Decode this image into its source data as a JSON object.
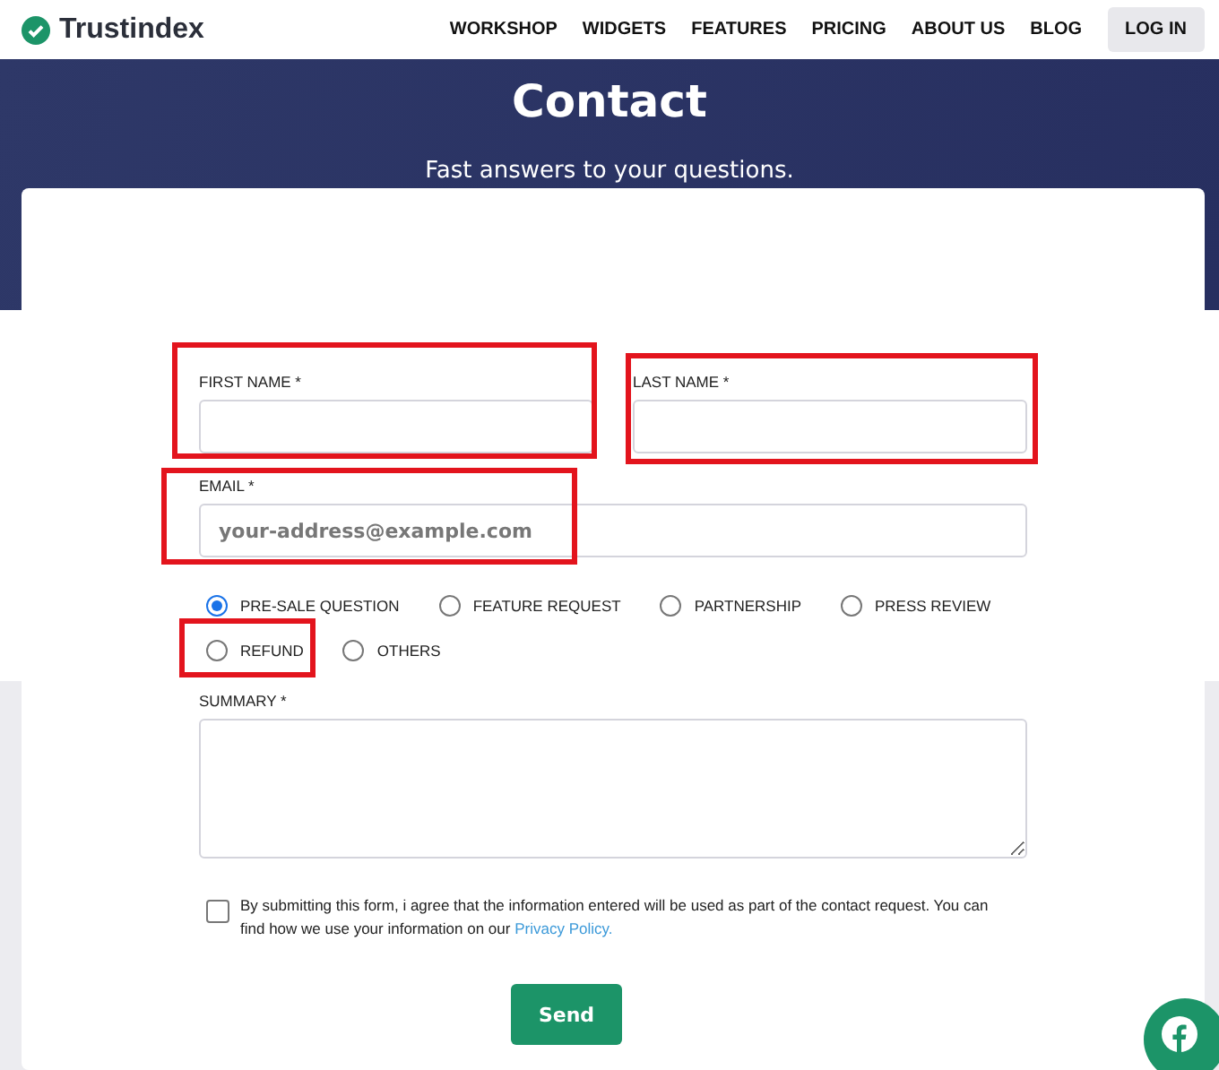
{
  "header": {
    "logo": "Trustindex",
    "nav": [
      {
        "label": "WORKSHOP",
        "kind": "link"
      },
      {
        "label": "WIDGETS",
        "kind": "link"
      },
      {
        "label": "FEATURES",
        "kind": "link"
      },
      {
        "label": "PRICING",
        "kind": "link"
      },
      {
        "label": "ABOUT US",
        "kind": "link"
      },
      {
        "label": "BLOG",
        "kind": "link"
      },
      {
        "label": "LOG IN",
        "kind": "button"
      }
    ]
  },
  "hero": {
    "title": "Contact",
    "subtitle": "Fast answers to your questions."
  },
  "form": {
    "name_fields": [
      {
        "label": "FIRST NAME *",
        "highlighted": true
      },
      {
        "label": "LAST NAME *",
        "highlighted": true
      }
    ],
    "email": {
      "label": "EMAIL *",
      "placeholder": "your-address@example.com",
      "highlighted": true
    },
    "topics": [
      {
        "label": "PRE-SALE QUESTION",
        "selected": true,
        "highlighted": false
      },
      {
        "label": "FEATURE REQUEST",
        "selected": false,
        "highlighted": false
      },
      {
        "label": "PARTNERSHIP",
        "selected": false,
        "highlighted": false
      },
      {
        "label": "PRESS REVIEW",
        "selected": false,
        "highlighted": false
      },
      {
        "label": "REFUND",
        "selected": false,
        "highlighted": true
      },
      {
        "label": "OTHERS",
        "selected": false,
        "highlighted": false
      }
    ],
    "summary": {
      "label": "SUMMARY *"
    },
    "consent": {
      "checked": false,
      "text": "By submitting this form, i agree that the information entered will be used as part of the contact request. You can find how we use your information on our",
      "link": "Privacy Policy."
    },
    "submit": "Send"
  }
}
